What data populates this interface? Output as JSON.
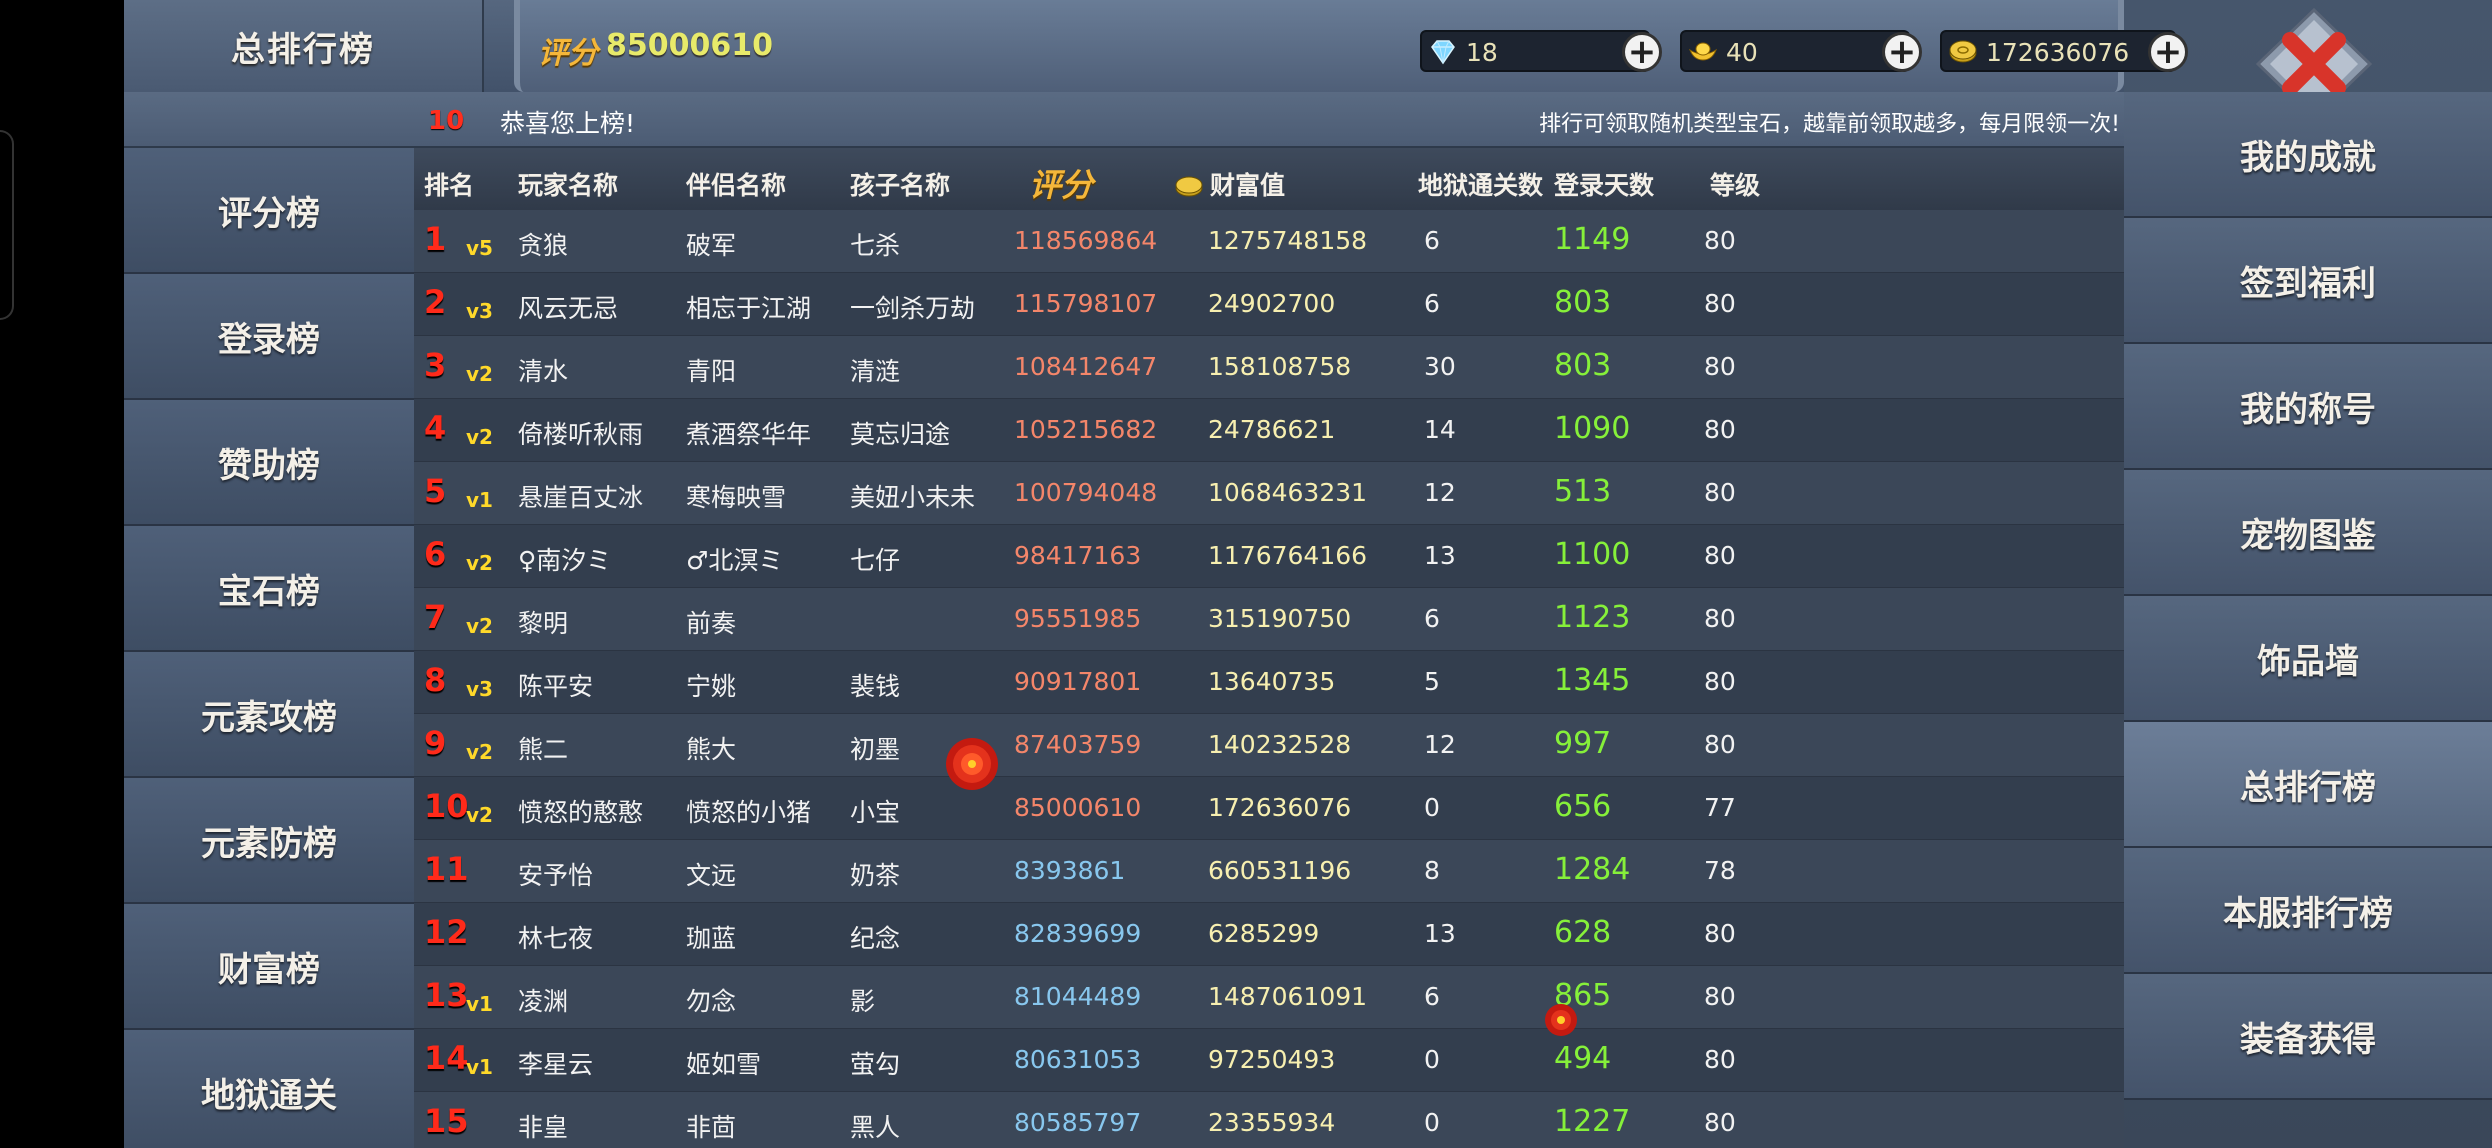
{
  "header": {
    "title": "总排行榜",
    "score_label": "评分",
    "score_value": "85000610"
  },
  "resources": {
    "diamond": "18",
    "gold": "40",
    "coins": "172636076",
    "plus": "+"
  },
  "notice": {
    "my_rank": "10",
    "congrats": "恭喜您上榜!",
    "info": "排行可领取随机类型宝石，越靠前领取越多，每月限领一次!"
  },
  "left_nav": [
    "评分榜",
    "登录榜",
    "赞助榜",
    "宝石榜",
    "元素攻榜",
    "元素防榜",
    "财富榜",
    "地狱通关"
  ],
  "right_nav": [
    "我的成就",
    "签到福利",
    "我的称号",
    "宠物图鉴",
    "饰品墙",
    "总排行榜",
    "本服排行榜",
    "装备获得"
  ],
  "right_nav_active": "总排行榜",
  "columns": {
    "rank": "排名",
    "player": "玩家名称",
    "partner": "伴侣名称",
    "child": "孩子名称",
    "score": "评分",
    "wealth": "财富值",
    "hell": "地狱通关数",
    "days": "登录天数",
    "level": "等级"
  },
  "rows": [
    {
      "rank": "1",
      "vip": "v5",
      "name": "贪狼",
      "partner": "破军",
      "child": "七杀",
      "score": "118569864",
      "wealth": "1275748158",
      "hell": "6",
      "days": "1149",
      "level": "80"
    },
    {
      "rank": "2",
      "vip": "v3",
      "name": "风云无忌",
      "partner": "相忘于江湖",
      "child": "一剑杀万劫",
      "score": "115798107",
      "wealth": "24902700",
      "hell": "6",
      "days": "803",
      "level": "80"
    },
    {
      "rank": "3",
      "vip": "v2",
      "name": "清水",
      "partner": "青阳",
      "child": "清涟",
      "score": "108412647",
      "wealth": "158108758",
      "hell": "30",
      "days": "803",
      "level": "80"
    },
    {
      "rank": "4",
      "vip": "v2",
      "name": "倚楼听秋雨",
      "partner": "煮酒祭华年",
      "child": "莫忘归途",
      "score": "105215682",
      "wealth": "24786621",
      "hell": "14",
      "days": "1090",
      "level": "80"
    },
    {
      "rank": "5",
      "vip": "v1",
      "name": "悬崖百丈冰",
      "partner": "寒梅映雪",
      "child": "美妞小未未",
      "score": "100794048",
      "wealth": "1068463231",
      "hell": "12",
      "days": "513",
      "level": "80"
    },
    {
      "rank": "6",
      "vip": "v2",
      "name": "♀南汐ミ",
      "partner": "♂北溟ミ",
      "child": "七仔",
      "score": "98417163",
      "wealth": "1176764166",
      "hell": "13",
      "days": "1100",
      "level": "80"
    },
    {
      "rank": "7",
      "vip": "v2",
      "name": "黎明",
      "partner": "前奏",
      "child": "",
      "score": "95551985",
      "wealth": "315190750",
      "hell": "6",
      "days": "1123",
      "level": "80"
    },
    {
      "rank": "8",
      "vip": "v3",
      "name": "陈平安",
      "partner": "宁姚",
      "child": "裴钱",
      "score": "90917801",
      "wealth": "13640735",
      "hell": "5",
      "days": "1345",
      "level": "80"
    },
    {
      "rank": "9",
      "vip": "v2",
      "name": "熊二",
      "partner": "熊大",
      "child": "初墨",
      "score": "87403759",
      "wealth": "140232528",
      "hell": "12",
      "days": "997",
      "level": "80"
    },
    {
      "rank": "10",
      "vip": "v2",
      "name": "愤怒的憨憨",
      "partner": "愤怒的小猪",
      "child": "小宝",
      "score": "85000610",
      "wealth": "172636076",
      "hell": "0",
      "days": "656",
      "level": "77"
    },
    {
      "rank": "11",
      "vip": "",
      "name": "安予怡",
      "partner": "文远",
      "child": "奶茶",
      "score": "8393861",
      "wealth": "660531196",
      "hell": "8",
      "days": "1284",
      "level": "78"
    },
    {
      "rank": "12",
      "vip": "",
      "name": "林七夜",
      "partner": "珈蓝",
      "child": "纪念",
      "score": "82839699",
      "wealth": "6285299",
      "hell": "13",
      "days": "628",
      "level": "80"
    },
    {
      "rank": "13",
      "vip": "v1",
      "name": "凌渊",
      "partner": "勿念",
      "child": "影",
      "score": "81044489",
      "wealth": "1487061091",
      "hell": "6",
      "days": "865",
      "level": "80"
    },
    {
      "rank": "14",
      "vip": "v1",
      "name": "李星云",
      "partner": "姬如雪",
      "child": "萤勾",
      "score": "80631053",
      "wealth": "97250493",
      "hell": "0",
      "days": "494",
      "level": "80"
    },
    {
      "rank": "15",
      "vip": "",
      "name": "非皇",
      "partner": "非茴",
      "child": "黑人",
      "score": "80585797",
      "wealth": "23355934",
      "hell": "0",
      "days": "1227",
      "level": "80"
    }
  ],
  "colors": {
    "rank": "#ff2a1a",
    "vip": "#ffd92a",
    "score_top": "#f4866a",
    "score_lower": "#88c7ee",
    "wealth": "#f7efb0",
    "days": "#86f03a"
  }
}
